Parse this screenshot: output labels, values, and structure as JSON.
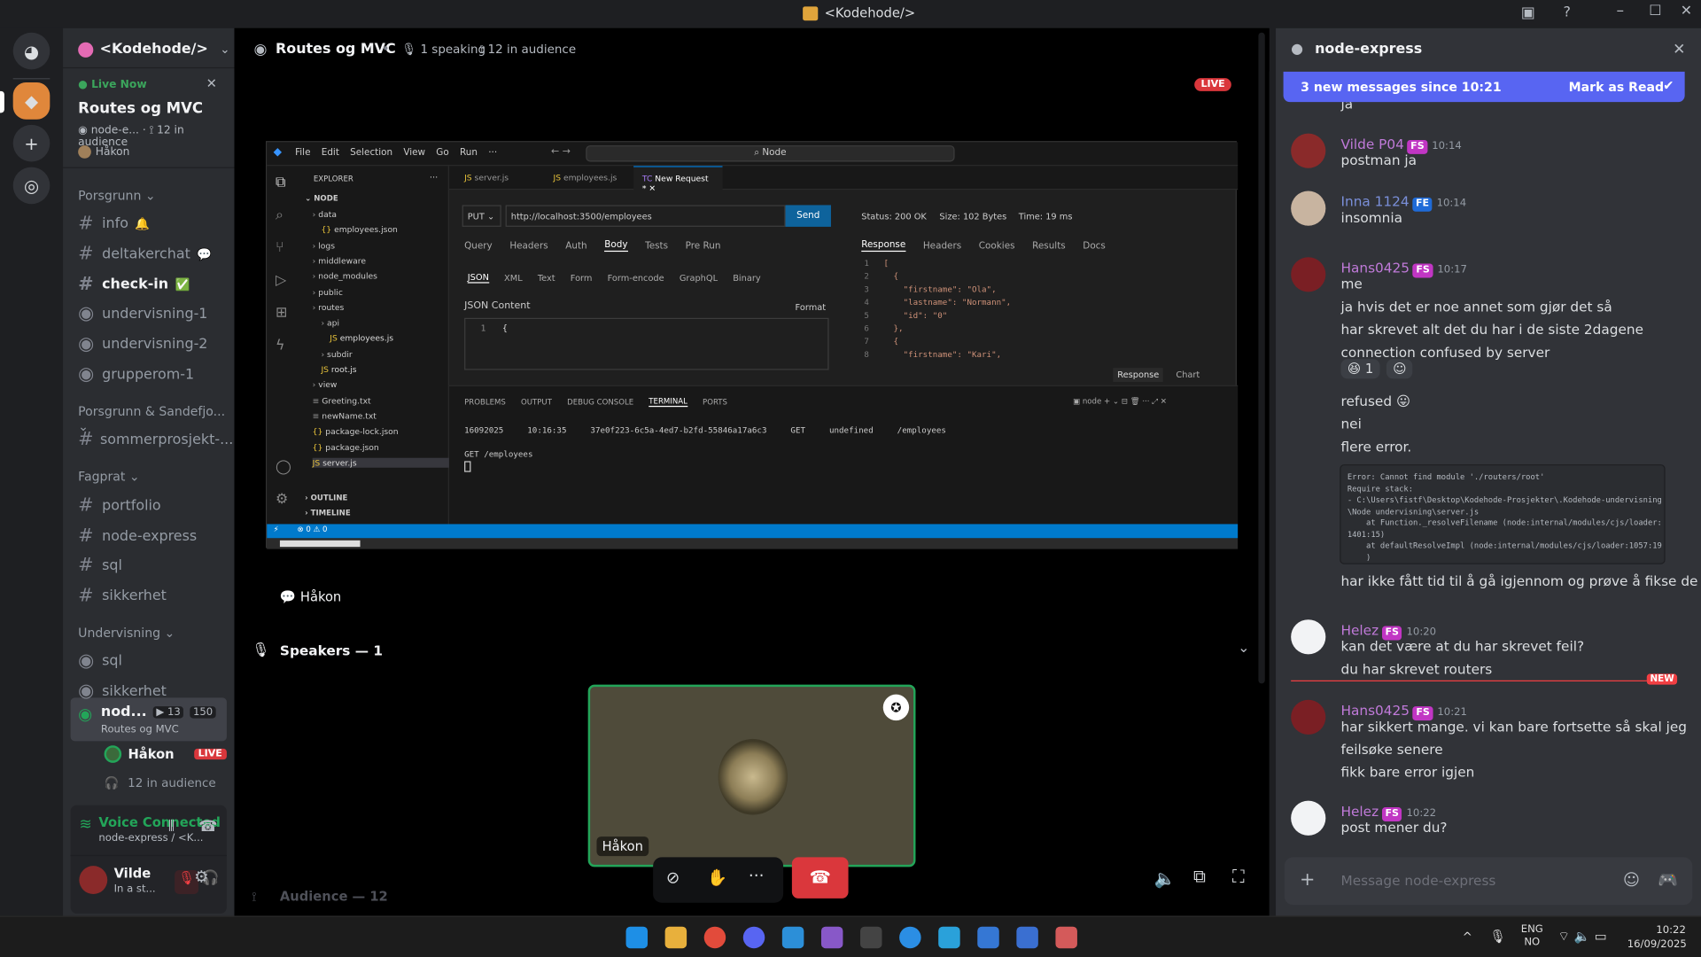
{
  "window": {
    "title": "<Kodehode/>"
  },
  "server": {
    "name": "<Kodehode/>",
    "live_label": "Live Now",
    "stage_title": "Routes og MVC",
    "stage_meta_channel": "node-e...",
    "stage_meta_audience": "12 in audience",
    "host": "Håkon"
  },
  "categories": [
    {
      "name": "Porsgrunn",
      "channels": [
        {
          "name": "info",
          "emoji": "🔔"
        },
        {
          "name": "deltakerchat",
          "emoji": "💬"
        },
        {
          "name": "check-in",
          "emoji": "✅"
        },
        {
          "name": "undervisning-1"
        },
        {
          "name": "undervisning-2"
        },
        {
          "name": "grupperom-1"
        }
      ]
    },
    {
      "name": "Porsgrunn & Sandefjo...",
      "channels": [
        {
          "name": "sommerprosjekt-..."
        }
      ]
    },
    {
      "name": "Fagprat",
      "channels": [
        {
          "name": "portfolio"
        },
        {
          "name": "node-express"
        },
        {
          "name": "sql"
        },
        {
          "name": "sikkerhet"
        }
      ]
    },
    {
      "name": "Undervisning",
      "channels": [
        {
          "name": "sql"
        },
        {
          "name": "sikkerhet"
        }
      ]
    }
  ],
  "active_stage": {
    "name": "nod...",
    "video_count": "13",
    "listeners": "150",
    "sub": "Routes og MVC",
    "speaker": "Håkon",
    "live": "LIVE",
    "audience": "12 in audience"
  },
  "voice": {
    "status": "Voice Connected",
    "channel": "node-express / <K..."
  },
  "user": {
    "name": "Vilde",
    "status": "In a st..."
  },
  "stage": {
    "title": "Routes og MVC",
    "speaking": "1 speaking",
    "audience": "12 in audience",
    "live": "LIVE",
    "presenter": "Håkon",
    "speakers_label": "Speakers — 1",
    "audience_label": "Audience — 12",
    "tile_name": "Håkon"
  },
  "vscode": {
    "menu": [
      "File",
      "Edit",
      "Selection",
      "View",
      "Go",
      "Run",
      "···"
    ],
    "search": "Node",
    "explorer_label": "EXPLORER",
    "root": "NODE",
    "tree": [
      "data",
      "employees.json",
      "logs",
      "middleware",
      "node_modules",
      "public",
      "routes",
      "api",
      "employees.js",
      "subdir",
      "root.js",
      "view",
      "Greeting.txt",
      "newName.txt",
      "package-lock.json",
      "package.json",
      "server.js"
    ],
    "outline": "OUTLINE",
    "timeline": "TIMELINE",
    "tabs": [
      "server.js",
      "employees.js",
      "New Request *"
    ],
    "method": "PUT",
    "url": "http://localhost:3500/employees",
    "send": "Send",
    "req_tabs": [
      "Query",
      "Headers",
      "Auth",
      "Body",
      "Tests",
      "Pre Run"
    ],
    "body_tabs": [
      "JSON",
      "XML",
      "Text",
      "Form",
      "Form-encode",
      "GraphQL",
      "Binary"
    ],
    "json_content": "JSON Content",
    "format": "Format",
    "line1": "1",
    "brace": "{",
    "status": "Status: 200 OK",
    "size": "Size: 102 Bytes",
    "time": "Time: 19 ms",
    "resp_tabs": [
      "Response",
      "Headers",
      "Cookies",
      "Results",
      "Docs"
    ],
    "resp_lines": [
      "[",
      "  {",
      "    \"firstname\": \"Ola\",",
      "    \"lastname\": \"Normann\",",
      "    \"id\": \"0\"",
      "  },",
      "  {",
      "    \"firstname\": \"Kari\","
    ],
    "resp_btn": "Response",
    "chart_btn": "Chart",
    "panel_tabs": [
      "PROBLEMS",
      "OUTPUT",
      "DEBUG CONSOLE",
      "TERMINAL",
      "PORTS"
    ],
    "term_row": [
      "16092025",
      "10:16:35",
      "37e0f223-6c5a-4ed7-b2fd-55846a17a6c3",
      "GET",
      "undefined",
      "/employees"
    ],
    "term_line2": "GET /employees",
    "term_shell": "node",
    "status_bar": "⊗ 0 ⚠ 0"
  },
  "chat": {
    "channel": "node-express",
    "banner": "3 new messages since 10:21",
    "mark_read": "Mark as Read",
    "partial": "ja",
    "messages": [
      {
        "user": "Vilde P04",
        "badge": "FS",
        "badge_color": "#c136c4",
        "name_color": "#c07ad9",
        "time": "10:14",
        "lines": [
          "postman ja"
        ]
      },
      {
        "user": "Inna 1124",
        "badge": "FE",
        "badge_color": "#1f6bd8",
        "name_color": "#7a8fd9",
        "time": "10:14",
        "lines": [
          "insomnia"
        ]
      },
      {
        "user": "Hans0425",
        "badge": "FS",
        "badge_color": "#c136c4",
        "name_color": "#c07ad9",
        "time": "10:17",
        "lines": [
          "me",
          "ja hvis det er noe annet som gjør det så",
          "har skrevet alt det du har i de siste 2dagene",
          "connection confused by server"
        ]
      },
      {
        "user": "Helez",
        "badge": "FS",
        "badge_color": "#c136c4",
        "name_color": "#c07ad9",
        "time": "10:20",
        "lines": [
          "kan det være at du har skrevet feil?",
          "du har skrevet routers"
        ]
      },
      {
        "user": "Hans0425",
        "badge": "FS",
        "badge_color": "#c136c4",
        "name_color": "#c07ad9",
        "time": "10:21",
        "lines": [
          "har sikkert mange. vi kan bare fortsette så skal jeg",
          "feilsøke senere",
          "fikk bare error igjen"
        ]
      },
      {
        "user": "Helez",
        "badge": "FS",
        "badge_color": "#c136c4",
        "name_color": "#c07ad9",
        "time": "10:22",
        "lines": [
          "post mener du?"
        ]
      }
    ],
    "reaction_count": "1",
    "extra_lines": [
      "refused",
      "nei",
      "flere error."
    ],
    "error_block": [
      "Error: Cannot find module './routers/root'",
      "Require stack:",
      "- C:\\Users\\fistf\\Desktop\\Kodehode-Prosjekter\\.Kodehode-undervisning",
      "\\Node undervisning\\server.js",
      "    at Function._resolveFilename (node:internal/modules/cjs/loader:",
      "1401:15)",
      "    at defaultResolveImpl (node:internal/modules/cjs/loader:1057:19",
      "    )"
    ],
    "after_error": "har ikke fått tid til å gå igjennom og prøve å fikse de",
    "new_label": "NEW",
    "placeholder": "Message node-express"
  },
  "taskbar": {
    "lang1": "ENG",
    "lang2": "NO",
    "time": "10:22",
    "date": "16/09/2025"
  }
}
